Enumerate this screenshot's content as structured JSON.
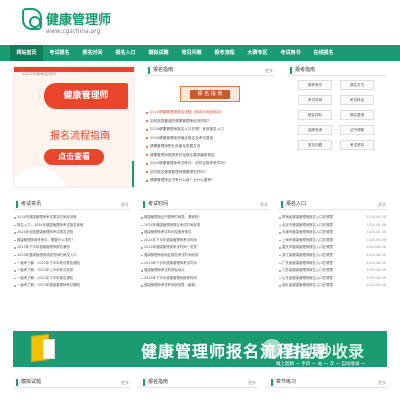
{
  "logo": {
    "title": "健康管理师",
    "url": "www.cgschina.org"
  },
  "nav": [
    "网站首页",
    "考试报名",
    "报名时间",
    "报名入口",
    "模拟试题",
    "常见问题",
    "报考流程",
    "大赛专区",
    "考试用书",
    "在线报名"
  ],
  "banner": {
    "caption": "2024年健康管理师",
    "card_title": "健康管理师",
    "subtitle": "报名流程指南",
    "button": "点击查看"
  },
  "guide": {
    "title": "报名指南",
    "more": "更多",
    "image_label": "报 名 指 南",
    "items": [
      {
        "text": "2024健康管理师报名流程（报名时间及网址）",
        "red": true
      },
      {
        "text": "如何选择靠谱的健康管理师培训机构？",
        "red": false
      },
      {
        "text": "2024健康管理师报名入口在哪？官网报名入口",
        "red": false
      },
      {
        "text": "2024健康管理师资格证报名及考试费用",
        "red": false
      },
      {
        "text": "健康管理师职业前景及发展方向",
        "red": false
      },
      {
        "text": "健康管理师报考条件及报名要求最新规定",
        "red": false
      },
      {
        "text": "2024健康管理师考试条件：你符合报考条件吗？",
        "red": false
      },
      {
        "text": "初次报名健康管理师需要哪些材料？",
        "red": false
      },
      {
        "text": "健康管理师证书有什么用？为什么要考？",
        "red": false
      }
    ]
  },
  "right_top": {
    "title": "报考指南",
    "buttons": [
      "报考条件",
      "报名方式",
      "考试时间",
      "考试科目",
      "报名材料",
      "报名费用",
      "成绩查询",
      "证书领取",
      "常见问题",
      "考试资料"
    ]
  },
  "col1": {
    "title": "考试资讯",
    "more": "更多",
    "items": [
      "2024年健康管理师考试报名时间及流程",
      "报名入口：2024年健康管理师考试报名官网",
      "2024年全国健康管理师考试报名须知",
      "健康管理师报考条件，需要什么学历？",
      "2023年下半年健康管理师报名通知",
      "2023年健康管理师成绩查询时间及入口",
      "一级考了解，2022年下半年考试报名通知",
      "一级考了解，2022年上半年考试安排",
      "一级考了解，2021年下半年报名通知",
      "一级考了解，2021年健康管理师考试通知"
    ]
  },
  "col2": {
    "title": "考试时间",
    "more": "更多",
    "items": [
      "健康管理师证书报考时间表，看我的！",
      "2024年健康管理师报名考试时间安排",
      "健康管理师考试时间及报考条件",
      "2024年下半年健康管理师考试时间",
      "2024年健康管理师考试时间一览表",
      "健康管理师各地区报名考试时间安排",
      "2023年下半年健康管理师考试时间",
      "健康管理师考试时间及地点",
      "2024年下半年健康管理师报考时间",
      "健康管理师考试时间安排表（最新）"
    ]
  },
  "col3": {
    "title": "报名入口",
    "more": "更多",
    "items": [
      "青海省健康管理师报名入口在哪里",
      "北京市健康管理师报名入口在哪里",
      "天津市健康管理师报名入口在哪里",
      "上海市健康管理师报名入口在哪里",
      "重庆市健康管理师报名入口在哪里",
      "浙江省健康管理师报名入口在哪里",
      "广东省健康管理师报名入口在哪里",
      "江苏省健康管理师报名入口在哪里",
      "山东省健康管理师报名入口在哪里",
      "湖北省健康管理师报名入口在哪里"
    ],
    "date": "2024-08-08"
  },
  "big_banner": {
    "title": "健康管理师报名流程指导",
    "wm_text": "自动秒收录",
    "wm_sub": "做上超精 一 手的 一 站 一 次 一 自动收录 一"
  },
  "footer": {
    "c1": "模拟试题",
    "c2": "报名指南",
    "c3": "章节练习",
    "more": "更多"
  }
}
